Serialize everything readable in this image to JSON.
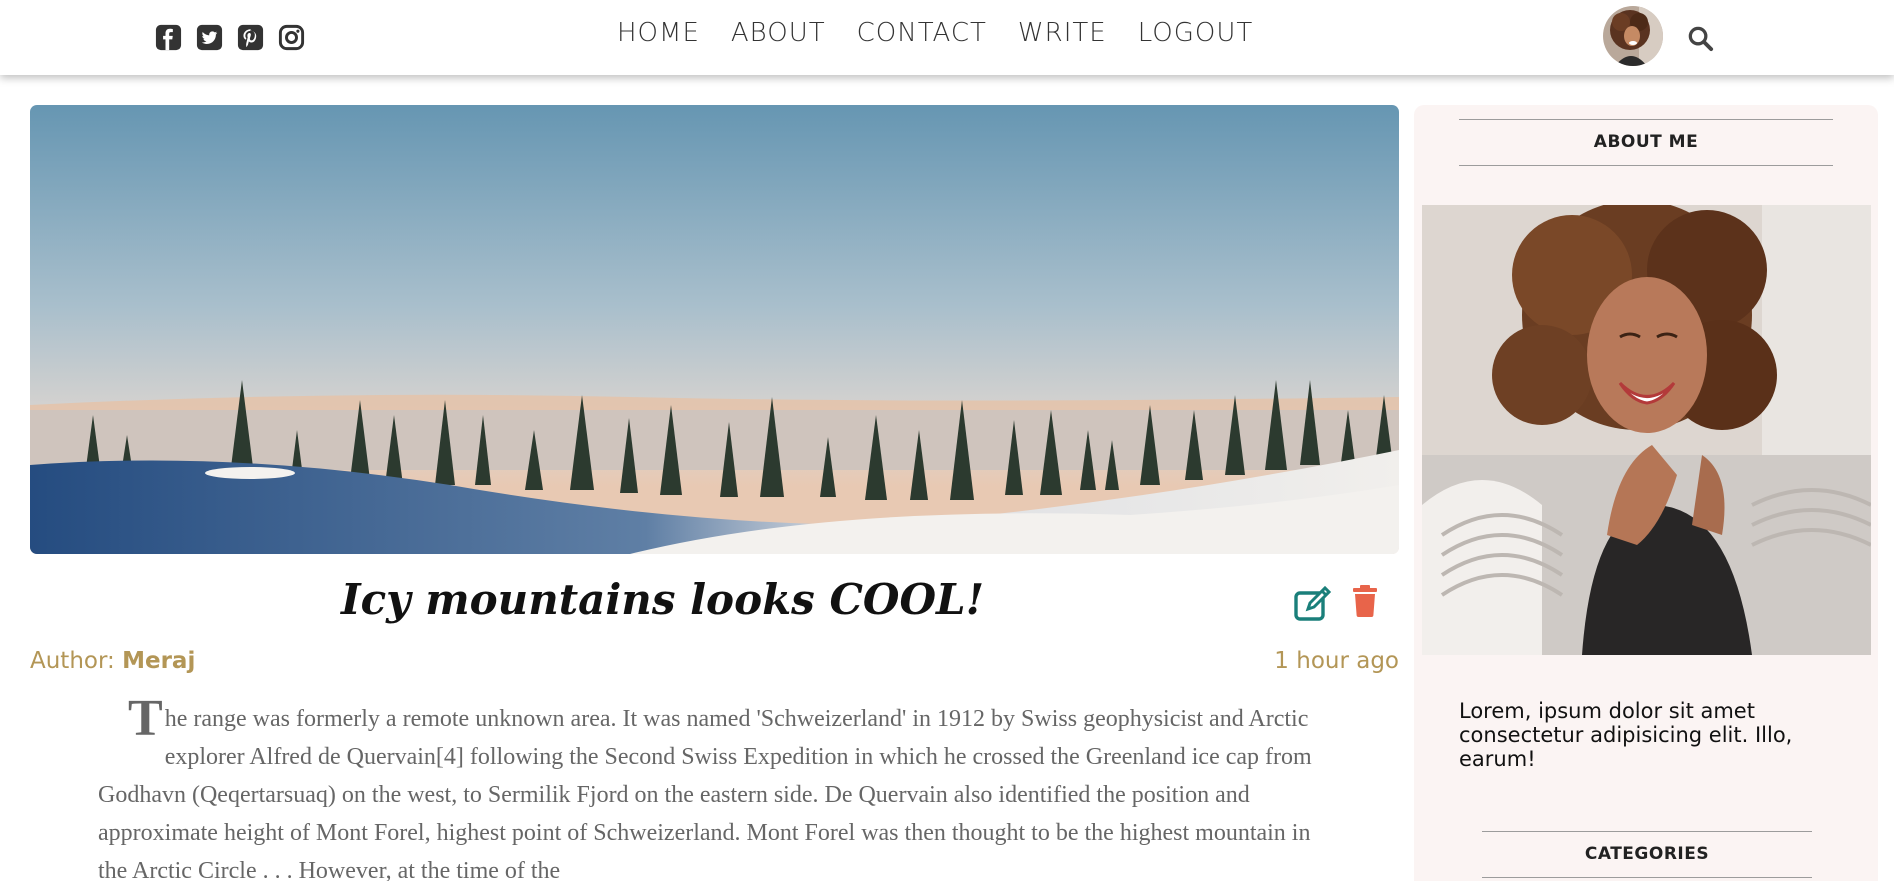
{
  "header": {
    "social_icons": [
      "facebook-square-icon",
      "twitter-square-icon",
      "pinterest-square-icon",
      "instagram-icon"
    ],
    "nav": [
      {
        "label": "HOME"
      },
      {
        "label": "ABOUT"
      },
      {
        "label": "CONTACT"
      },
      {
        "label": "WRITE"
      },
      {
        "label": "LOGOUT"
      }
    ],
    "icons": [
      "avatar",
      "search-icon"
    ]
  },
  "post": {
    "title": "Icy mountains looks COOL!",
    "author_label": "Author: ",
    "author_name": "Meraj",
    "time": "1 hour ago",
    "body_first_letter": "T",
    "body_rest": "he range was formerly a remote unknown area. It was named 'Schweizerland' in 1912 by Swiss geophysicist and Arctic explorer Alfred de Quervain[4] following the Second Swiss Expedition in which he crossed the Greenland ice cap from Godhavn (Qeqertarsuaq) on the west, to Sermilik Fjord on the eastern side. De Quervain also identified the position and approximate height of Mont Forel, highest point of Schweizerland. Mont Forel was then thought to be the highest mountain in the Arctic Circle . . . However, at the time of the",
    "actions": [
      "edit-icon",
      "trash-icon"
    ]
  },
  "sidebar": {
    "about_title": "ABOUT ME",
    "about_text": "Lorem, ipsum dolor sit amet consectetur adipisicing elit. Illo, earum!",
    "categories_title": "CATEGORIES"
  },
  "colors": {
    "accent_gold": "#b39656",
    "edit_teal": "#1a7f7a",
    "delete_red": "#e8644a",
    "sidebar_bg": "#fbf4f3"
  }
}
